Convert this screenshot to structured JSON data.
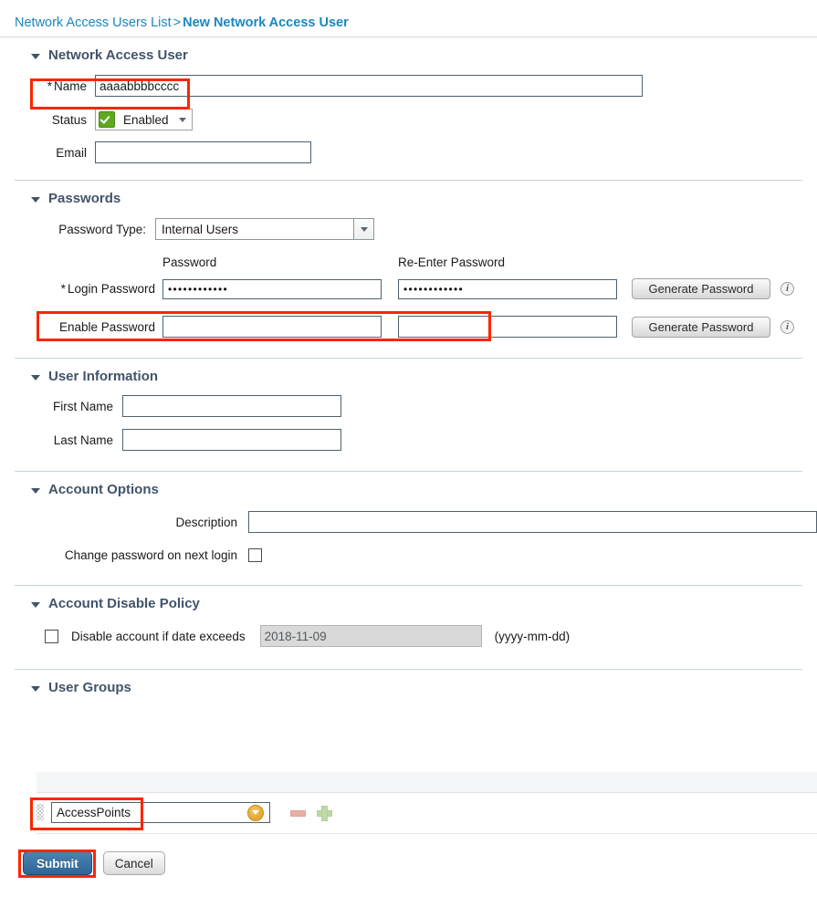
{
  "breadcrumb": {
    "parent": "Network Access Users List",
    "separator": ">",
    "current": "New Network Access User"
  },
  "sections": {
    "network_access_user": {
      "title": "Network Access User",
      "name_label": "Name",
      "name_required_mark": "*",
      "name_value": "aaaabbbbcccc",
      "status_label": "Status",
      "status_value": "Enabled",
      "email_label": "Email",
      "email_value": ""
    },
    "passwords": {
      "title": "Passwords",
      "password_type_label": "Password Type:",
      "password_type_value": "Internal Users",
      "col_password": "Password",
      "col_reenter": "Re-Enter Password",
      "login_password_label": "Login Password",
      "login_password_required_mark": "*",
      "login_password_value": "••••••••••••",
      "login_password_reenter_value": "••••••••••••",
      "enable_password_label": "Enable Password",
      "enable_password_value": "",
      "enable_password_reenter_value": "",
      "generate_password_label": "Generate Password",
      "info_icon_label": "i"
    },
    "user_information": {
      "title": "User Information",
      "first_name_label": "First Name",
      "first_name_value": "",
      "last_name_label": "Last Name",
      "last_name_value": ""
    },
    "account_options": {
      "title": "Account Options",
      "description_label": "Description",
      "description_value": "",
      "change_password_label": "Change password on next login",
      "change_password_checked": false
    },
    "account_disable_policy": {
      "title": "Account Disable Policy",
      "disable_label": "Disable account if date exceeds",
      "disable_checked": false,
      "date_value": "2018-11-09",
      "date_format_hint": "(yyyy-mm-dd)"
    },
    "user_groups": {
      "title": "User Groups",
      "rows": [
        {
          "value": "AccessPoints"
        }
      ]
    }
  },
  "footer": {
    "submit_label": "Submit",
    "cancel_label": "Cancel"
  },
  "colors": {
    "breadcrumb_link": "#1a87bf",
    "section_header": "#41546b",
    "annotation": "#fa2600",
    "status_enabled": "#5fa821",
    "submit_button": "#2e6696"
  }
}
